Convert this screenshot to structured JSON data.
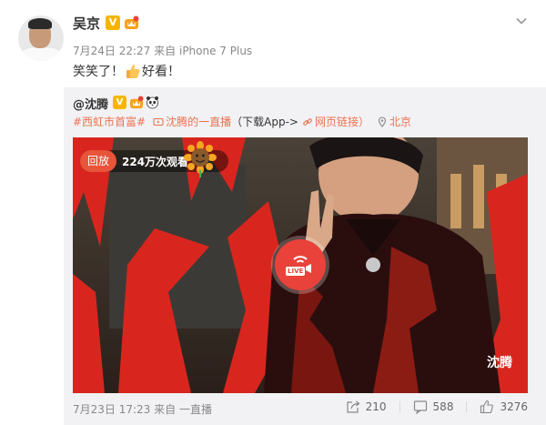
{
  "post": {
    "author": "吴京",
    "date": "7月24日 22:27",
    "source_prefix": "来自",
    "source": "iPhone 7 Plus",
    "text_before": "笑笑了！",
    "text_after": "好看！",
    "thumb_emoji": "thumbs-up-icon"
  },
  "repost": {
    "author": "@沈腾",
    "topic_tag": "#西虹市首富#",
    "live_link": "沈腾的一直播",
    "download_link": "（下载App->",
    "web_link": "网页链接）",
    "location": "北京",
    "video": {
      "replay_label": "回放",
      "viewers": "224万次观看",
      "live_label": "LIVE",
      "corner_text": "沈腾"
    },
    "date": "7月23日 17:23",
    "source_prefix": "来自",
    "source": "一直播",
    "reposts": "210",
    "comments": "588",
    "likes": "3276"
  },
  "colors": {
    "accent": "#eb7350",
    "verified": "#f7b500",
    "live_red": "#e8423a"
  }
}
